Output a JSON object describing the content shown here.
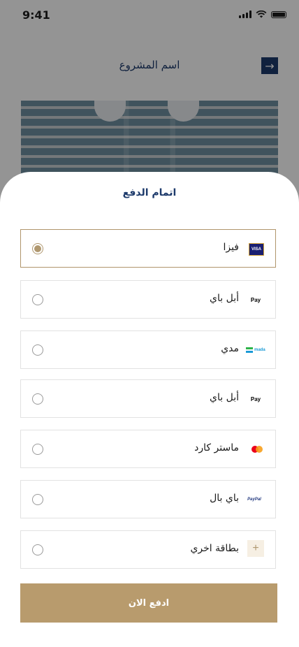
{
  "status_bar": {
    "time": "9:41"
  },
  "background_page": {
    "title": "اسم المشروع",
    "arrow": "→"
  },
  "sheet": {
    "title": "اتمام الدفع",
    "methods": [
      {
        "label": "فيزا",
        "icon": "visa-icon",
        "icon_text": "VISA",
        "selected": true
      },
      {
        "label": "أبل باي",
        "icon": "apple-pay-icon",
        "icon_text": " Pay",
        "selected": false
      },
      {
        "label": "مدي",
        "icon": "mada-icon",
        "icon_text": "mada",
        "selected": false
      },
      {
        "label": "أبل باي",
        "icon": "apple-pay-icon",
        "icon_text": " Pay",
        "selected": false
      },
      {
        "label": "ماستر كارد",
        "icon": "mastercard-icon",
        "selected": false
      },
      {
        "label": "باي بال",
        "icon": "paypal-icon",
        "icon_text": "PayPal",
        "selected": false
      },
      {
        "label": "بطاقة اخري",
        "icon": "plus-icon",
        "icon_text": "+",
        "selected": false
      }
    ],
    "pay_button": "ادفع الان"
  },
  "colors": {
    "accent": "#b89b6d",
    "primary": "#1d3a6b",
    "selected_border": "#b0956b"
  }
}
